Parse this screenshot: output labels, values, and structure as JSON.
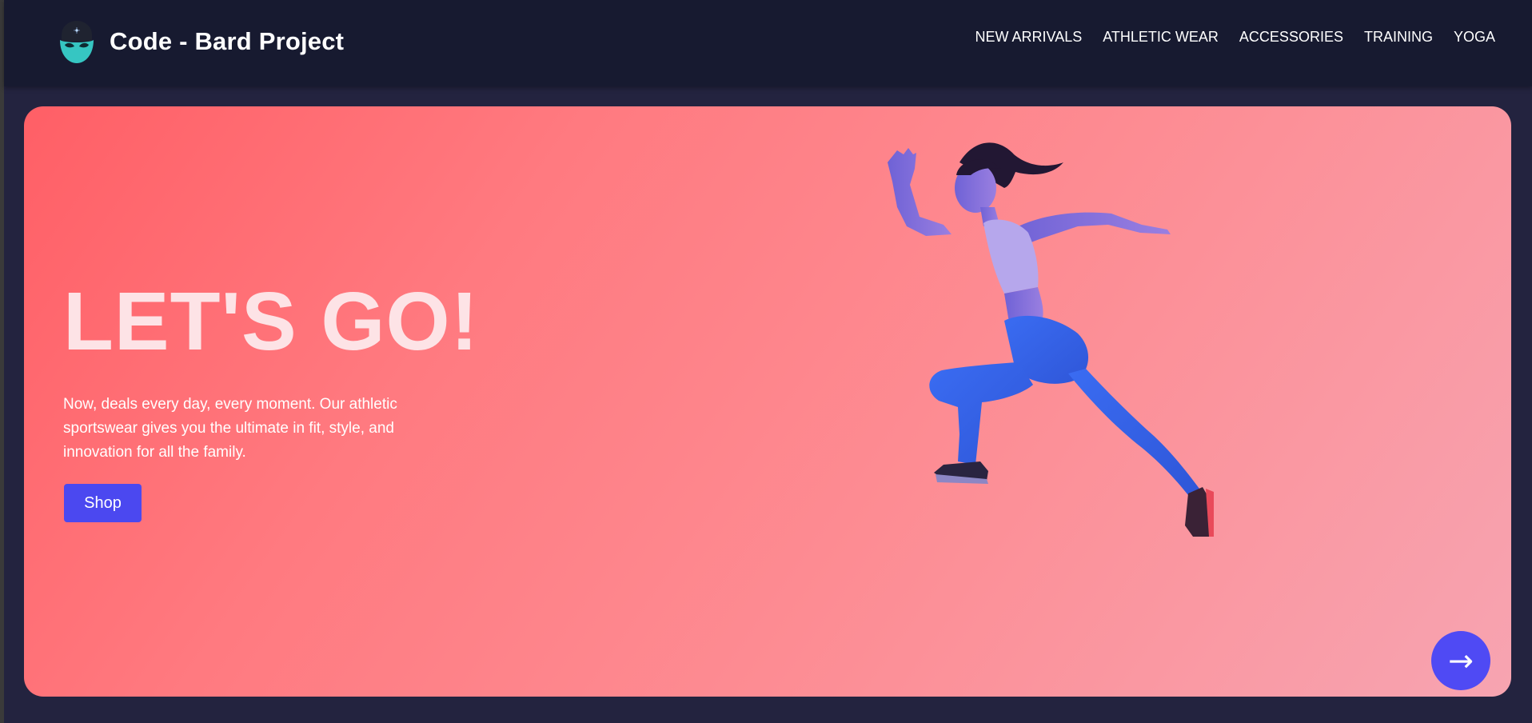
{
  "header": {
    "brand_title": "Code - Bard Project",
    "logo_icon": "masked-face-logo-icon",
    "nav": [
      {
        "label": "NEW ARRIVALS"
      },
      {
        "label": "ATHLETIC WEAR"
      },
      {
        "label": "ACCESSORIES"
      },
      {
        "label": "TRAINING"
      },
      {
        "label": "YOGA"
      }
    ]
  },
  "hero": {
    "heading": "LET'S GO!",
    "text": "Now, deals every day, every moment. Our athletic sportswear gives you the ultimate in fit, style, and innovation for all the family.",
    "shop_label": "Shop",
    "image": "runner-photo",
    "next_label": "→",
    "next_icon": "arrow-right-icon"
  },
  "colors": {
    "nav_bg": "#171a30",
    "page_bg": "#23233f",
    "hero_gradient_start": "#ff5f66",
    "hero_gradient_end": "#f7a4b1",
    "accent": "#4b48f0"
  }
}
